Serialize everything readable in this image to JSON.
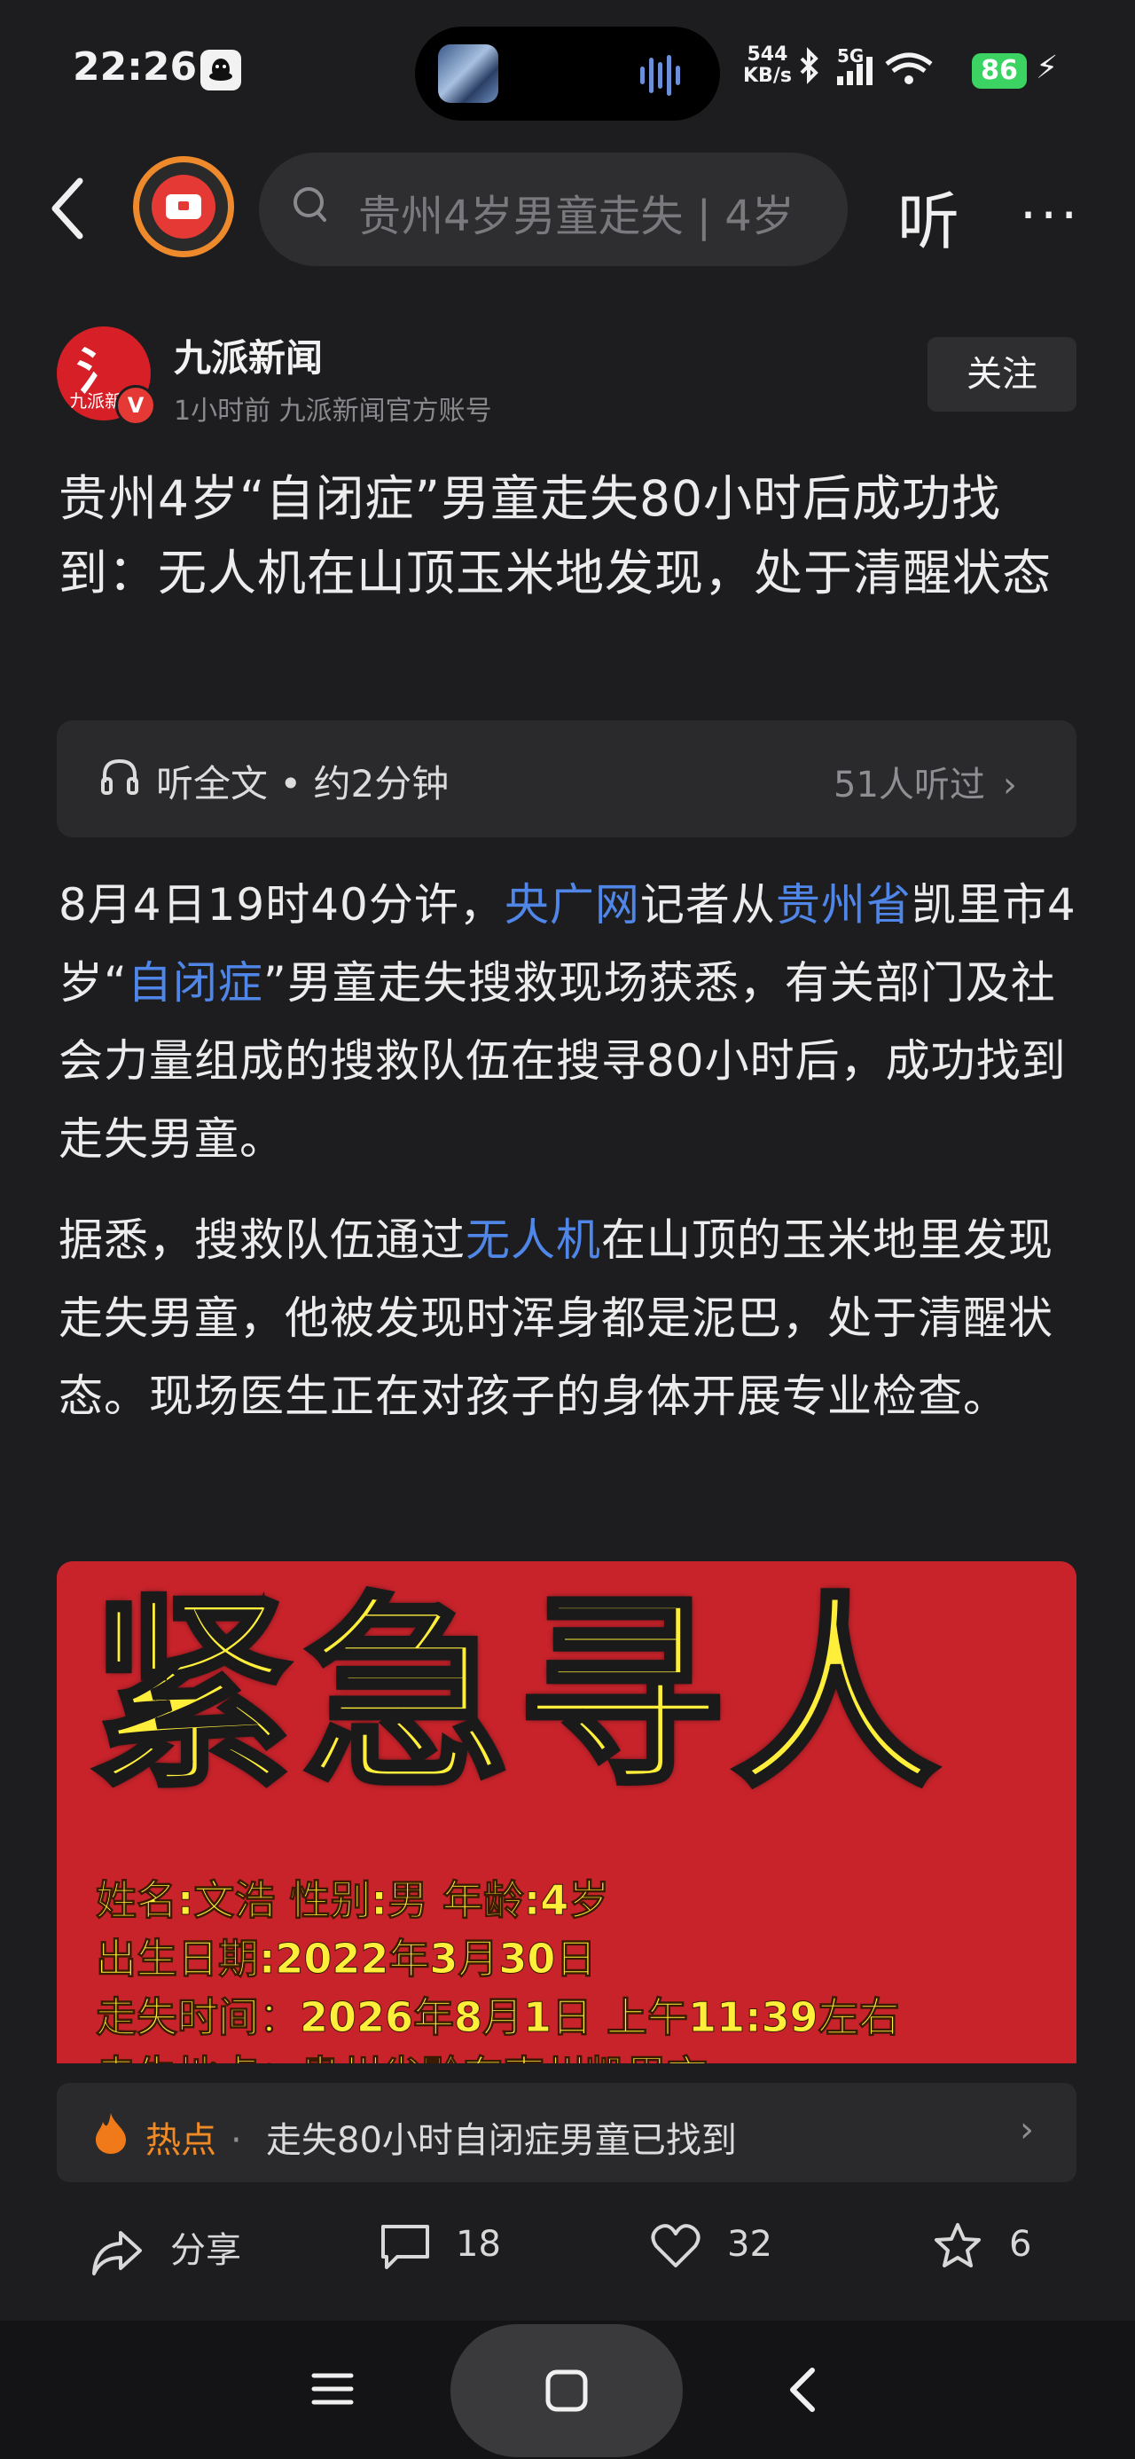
{
  "status": {
    "time": "22:26",
    "net_speed_value": "544",
    "net_speed_unit": "KB/s",
    "network": "5G",
    "battery": "86"
  },
  "nav": {
    "search_placeholder": "贵州4岁男童走失 | 4岁",
    "listen_label": "听"
  },
  "author": {
    "name": "九派新闻",
    "meta": "1小时前  九派新闻官方账号",
    "follow_label": "关注",
    "logo_text": "九派新闻"
  },
  "article": {
    "title": "贵州4岁“自闭症”男童走失80小时后成功找到：无人机在山顶玉米地发现，处于清醒状态",
    "audio": {
      "label": "听全文 • 约2分钟",
      "count": "51人听过"
    },
    "p1": {
      "t1": "8月4日19时40分许，",
      "l1": "央广网",
      "t2": "记者从",
      "l2": "贵州省",
      "t3": "凯里市4岁“",
      "l3": "自闭症",
      "t4": "”男童走失搜救现场获悉，有关部门及社会力量组成的搜救队伍在搜寻80小时后，成功找到走失男童。"
    },
    "p2": {
      "t1": "据悉，搜救队伍通过",
      "l1": "无人机",
      "t2": "在山顶的玉米地里发现走失男童，他被发现时浑身都是泥巴，处于清醒状态。现场医生正在对孩子的身体开展专业检查。"
    }
  },
  "poster": {
    "headline": "紧急寻人",
    "line1": "姓名:文浩      性别:男      年龄:4岁",
    "line2": "出生日期:2022年3月30日",
    "line3": "走失时间：2026年8月1日 上午11:39左右",
    "line4": "走失地点：贵州省黔东南州凯里市"
  },
  "hot": {
    "tag": "热点",
    "sep": "·",
    "text": "走失80小时自闭症男童已找到"
  },
  "actions": {
    "share": "分享",
    "comments": "18",
    "likes": "32",
    "favorites": "6"
  },
  "colors": {
    "link": "#4f86e8",
    "accent_orange": "#f08a24",
    "brand_red": "#d61f26",
    "battery_green": "#3bd463"
  }
}
